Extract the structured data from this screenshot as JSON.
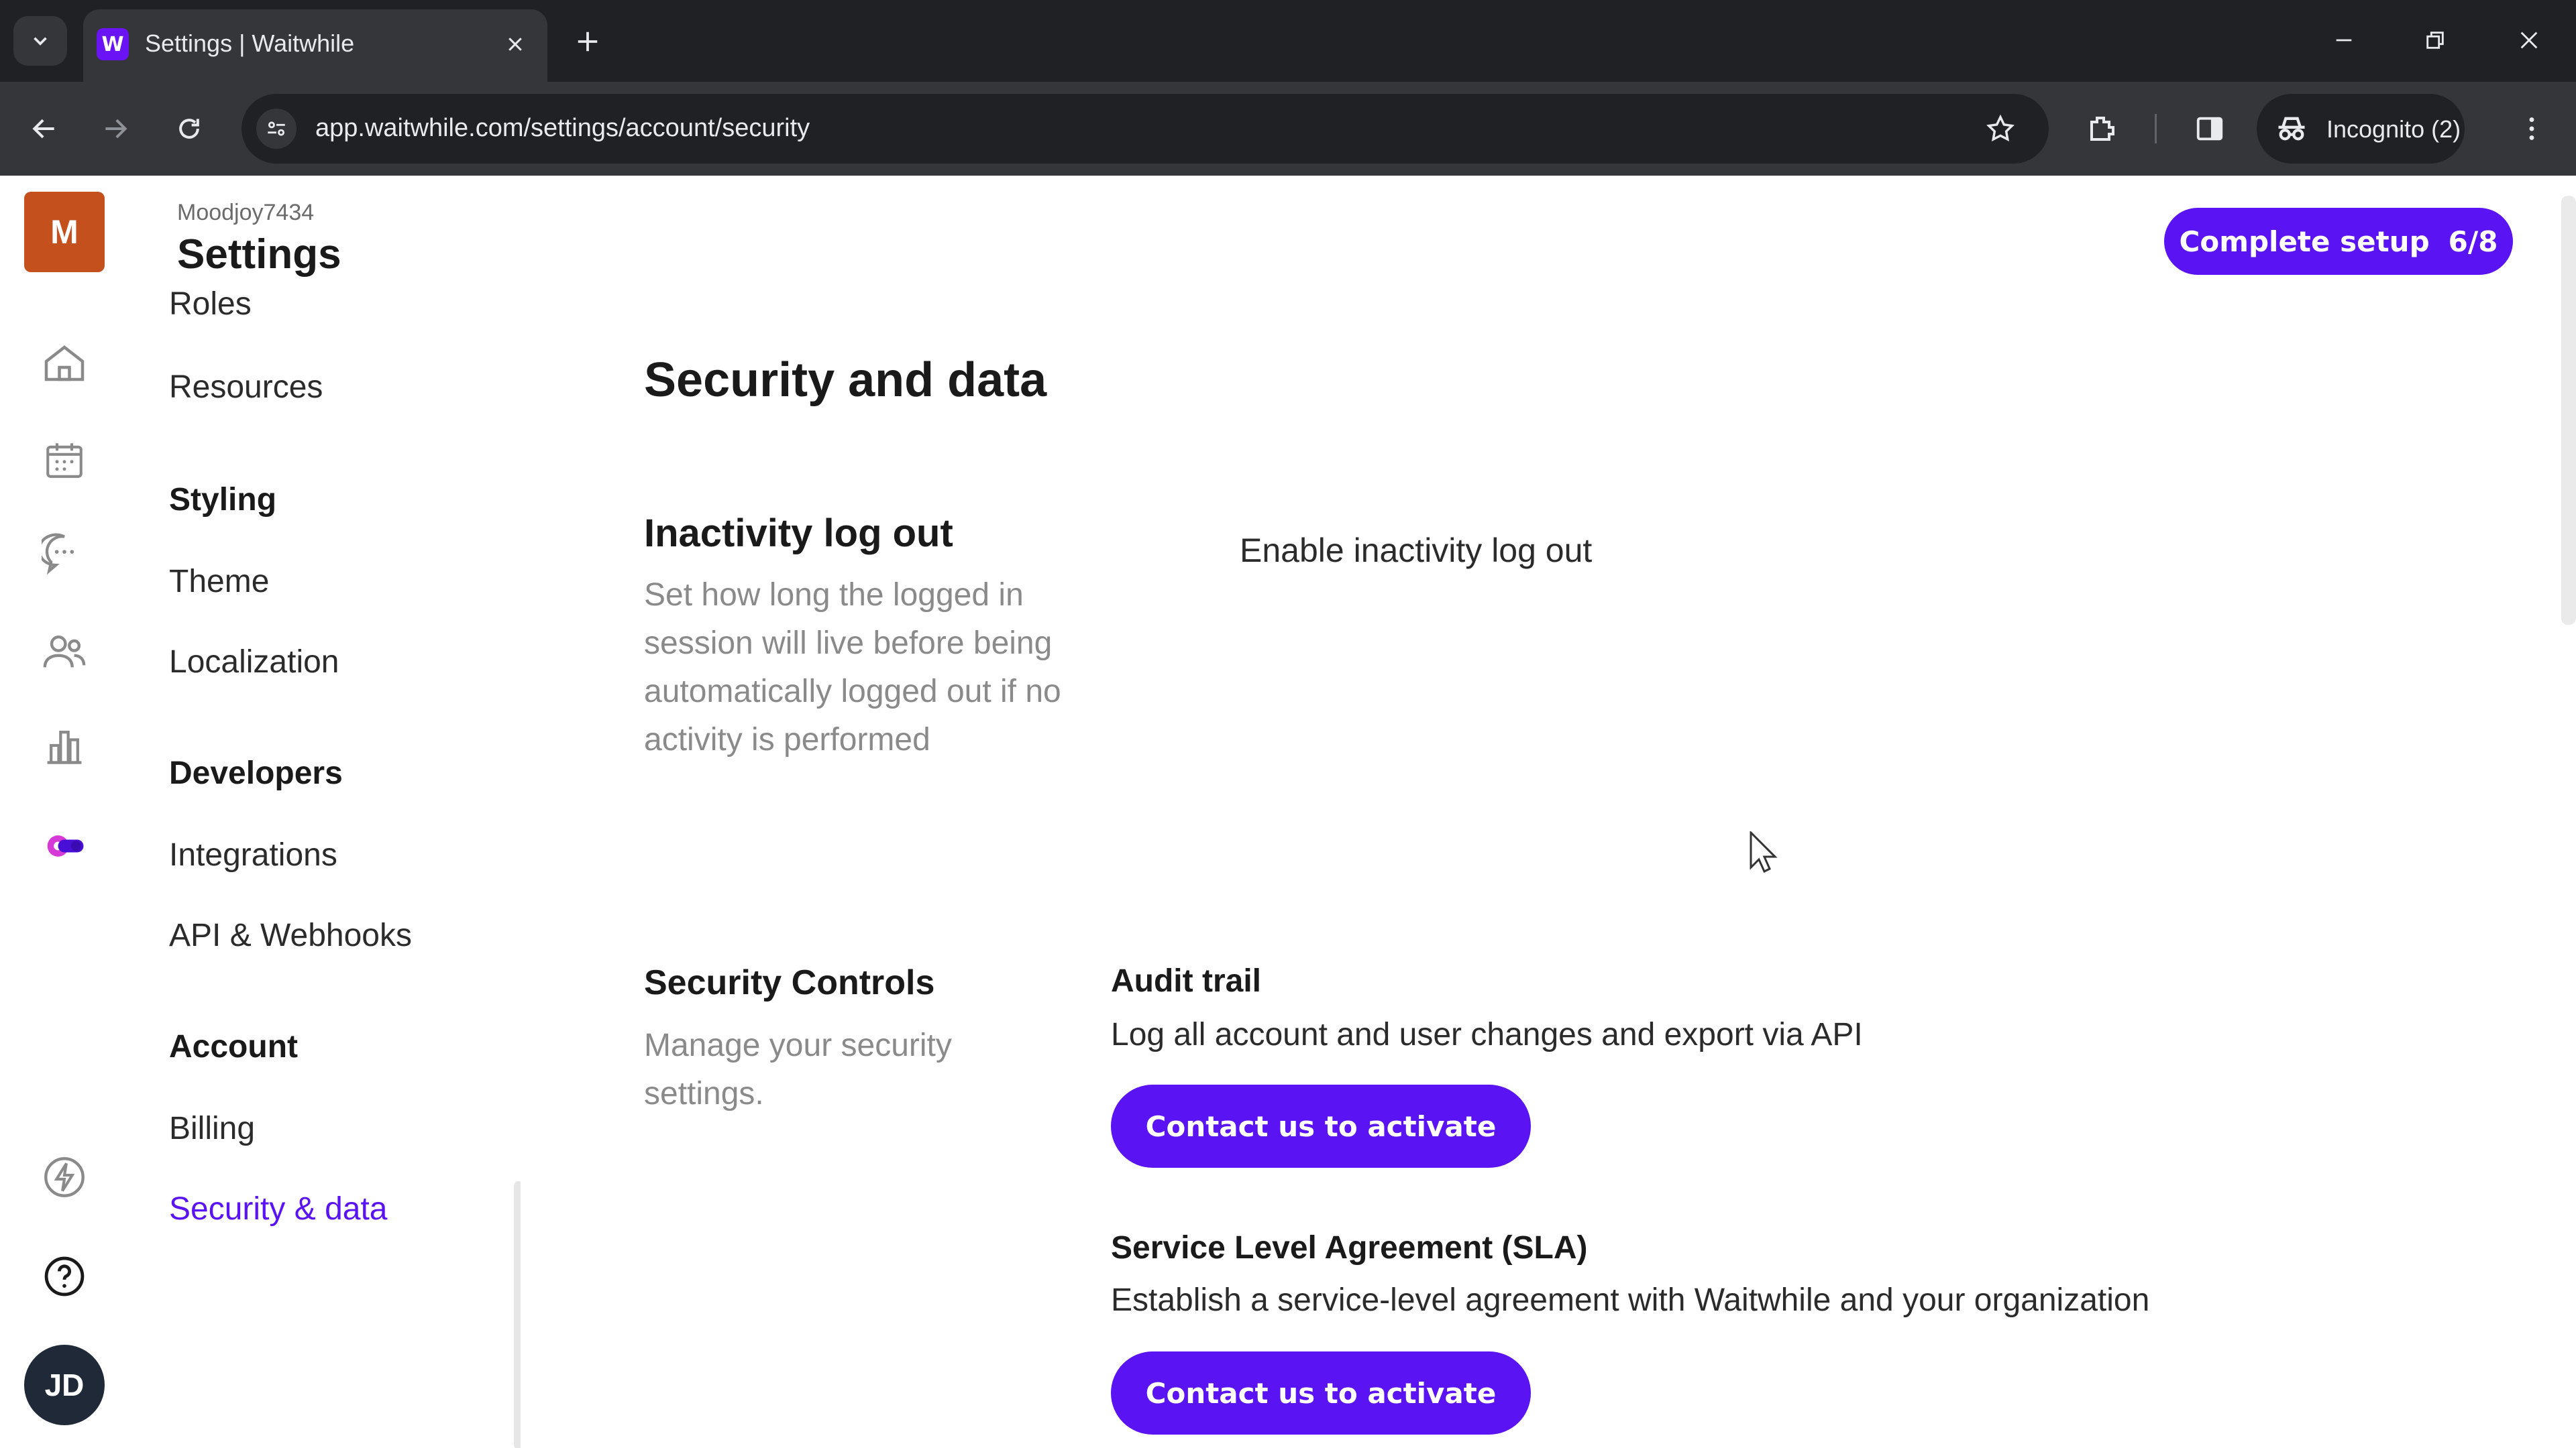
{
  "browser": {
    "tab_title": "Settings | Waitwhile",
    "favicon_letter": "W",
    "url": "app.waitwhile.com/settings/account/security",
    "incognito_label": "Incognito (2)"
  },
  "header": {
    "org_name": "Moodjoy7434",
    "title": "Settings",
    "setup_label": "Complete setup",
    "setup_progress": "6/8"
  },
  "rail": {
    "org_initial": "M",
    "user_initials": "JD"
  },
  "nav": {
    "items": [
      {
        "label": "Roles"
      },
      {
        "label": "Resources"
      },
      {
        "label": "Styling"
      },
      {
        "label": "Theme"
      },
      {
        "label": "Localization"
      },
      {
        "label": "Developers"
      },
      {
        "label": "Integrations"
      },
      {
        "label": "API & Webhooks"
      },
      {
        "label": "Account"
      },
      {
        "label": "Billing"
      },
      {
        "label": "Security & data"
      }
    ]
  },
  "main": {
    "page_title": "Security and data",
    "inactivity": {
      "heading": "Inactivity log out",
      "description": "Set how long the logged in session will live before being automatically logged out if no activity is performed",
      "toggle_label": "Enable inactivity log out"
    },
    "security_controls": {
      "heading": "Security Controls",
      "description": "Manage your security settings.",
      "features": [
        {
          "title": "Audit trail",
          "description": "Log all account and user changes and export via API",
          "button": "Contact us to activate"
        },
        {
          "title": "Service Level Agreement (SLA)",
          "description": "Establish a service-level agreement with Waitwhile and your organization",
          "button": "Contact us to activate"
        }
      ]
    }
  },
  "colors": {
    "brand": "#5a13f2",
    "org_avatar": "#c4501e",
    "chrome_dark": "#202124",
    "chrome_toolbar": "#35363a"
  }
}
